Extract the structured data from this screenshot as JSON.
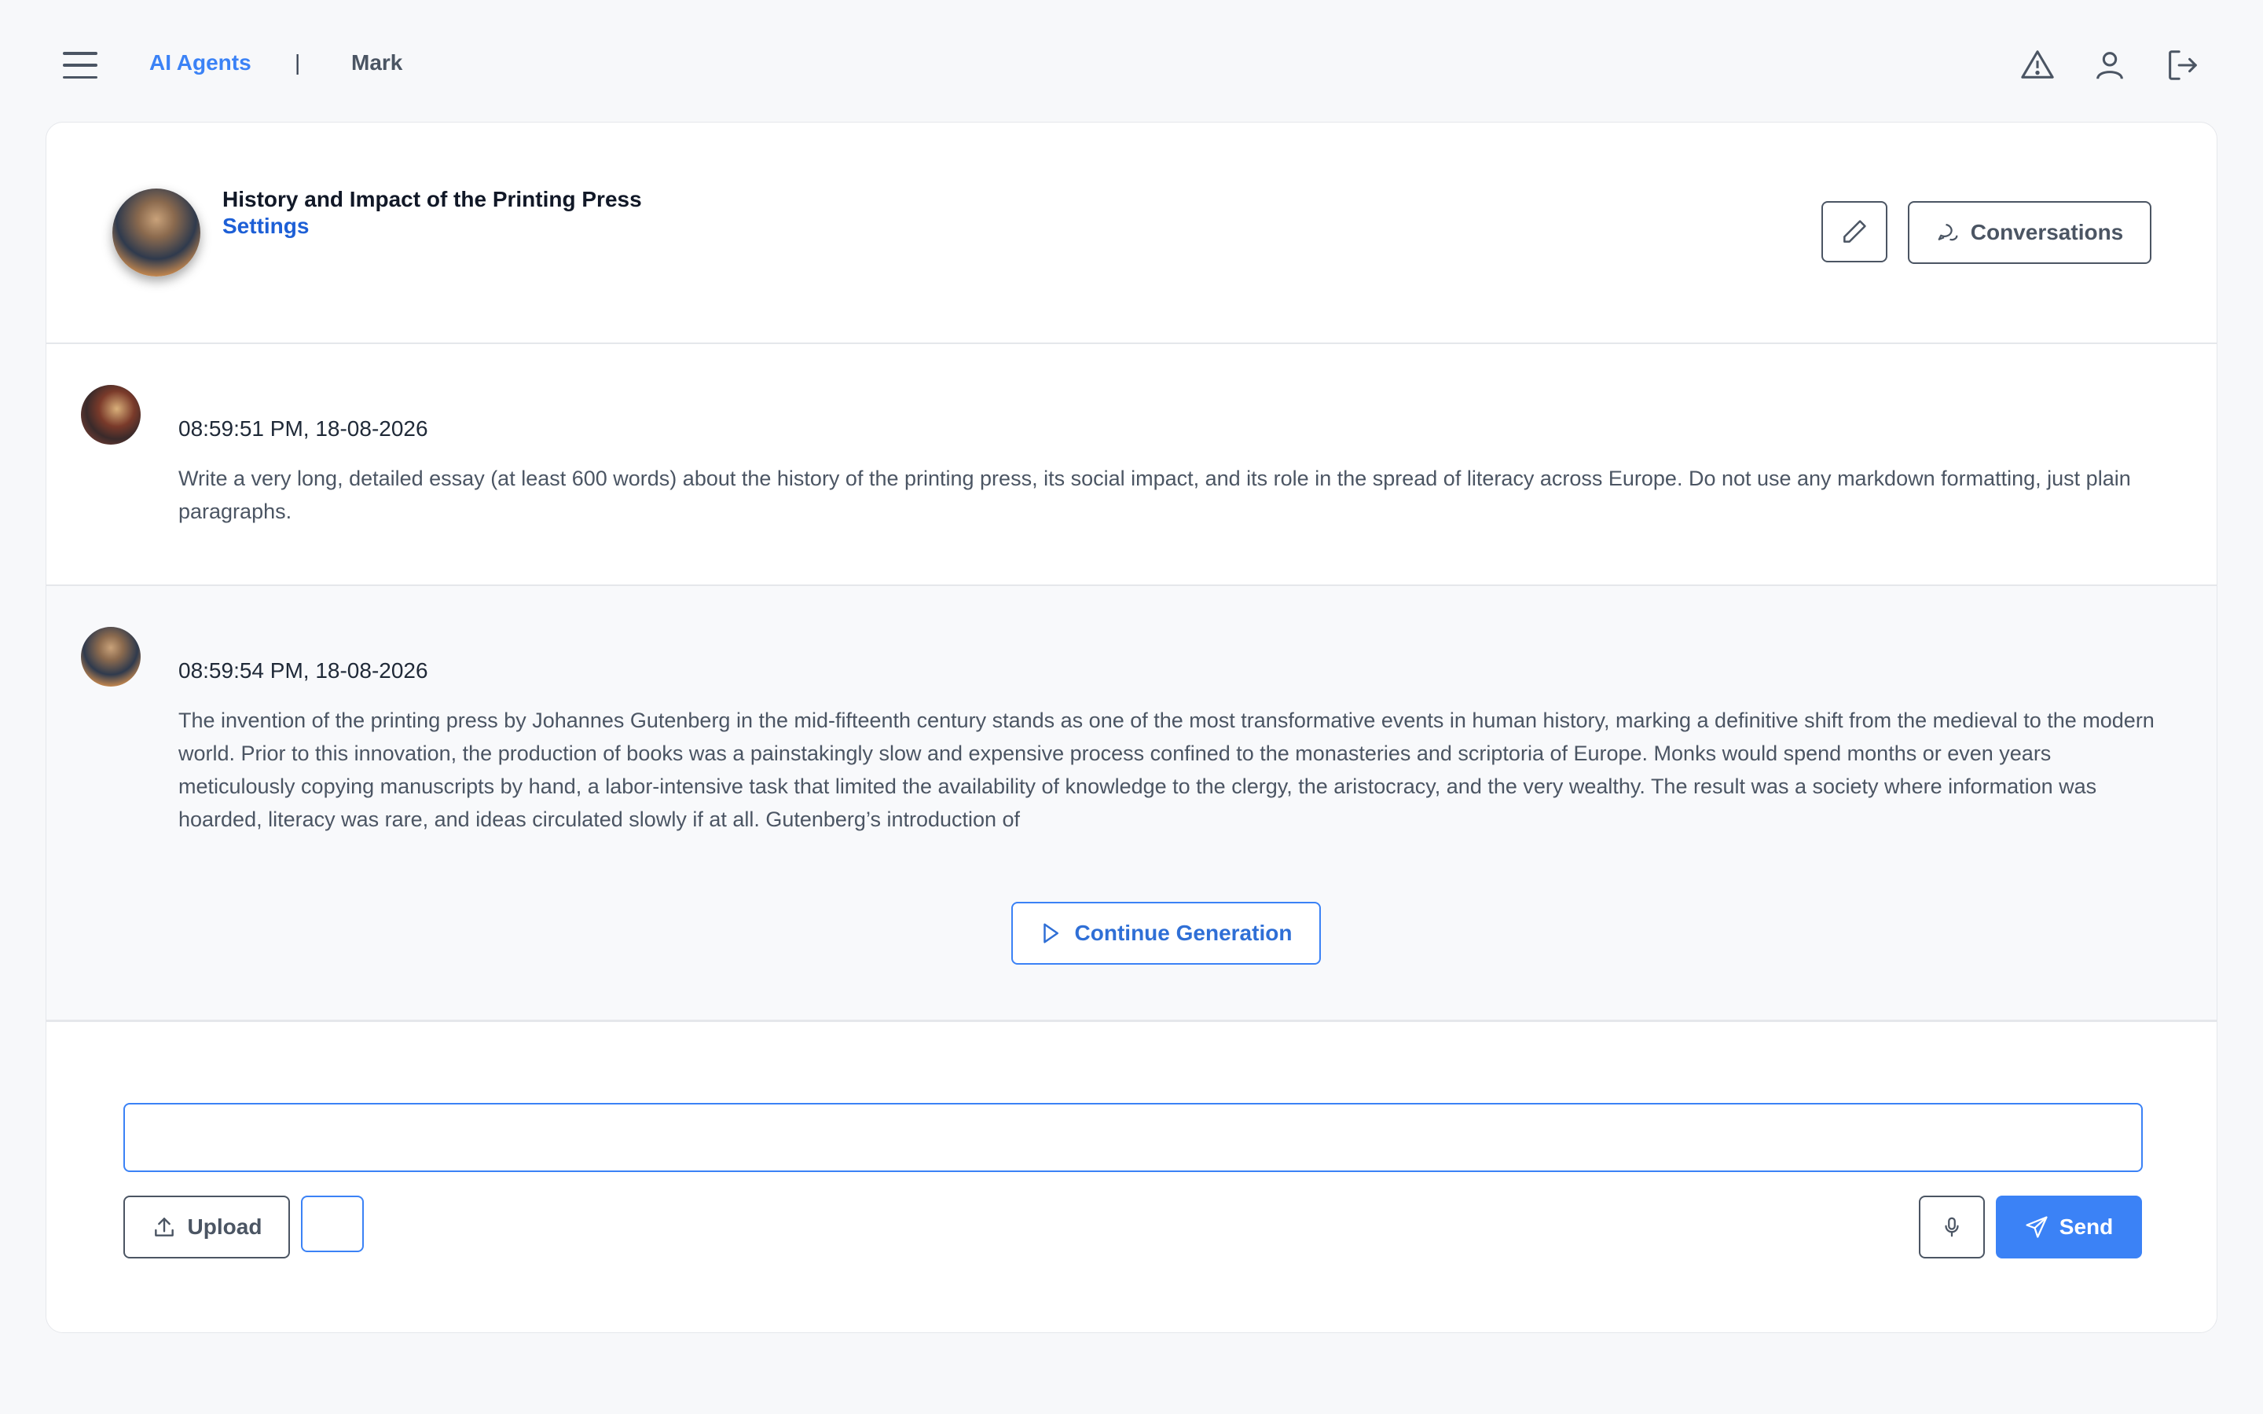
{
  "topbar": {
    "breadcrumb_home": "AI Agents",
    "breadcrumb_sep": "|",
    "breadcrumb_current": "Mark",
    "icons": [
      "menu-icon",
      "warning-icon",
      "user-icon",
      "logout-icon"
    ]
  },
  "agent": {
    "title": "History and Impact of the Printing Press",
    "settings_label": "Settings",
    "conversations_label": "Conversations"
  },
  "messages": [
    {
      "role": "user",
      "time": "08:59:51 PM, 18-08-2026",
      "text": "Write a very long, detailed essay (at least 600 words) about the history of the printing press, its social impact, and its role in the spread of literacy across Europe. Do not use any markdown formatting, just plain paragraphs."
    },
    {
      "role": "agent",
      "time": "08:59:54 PM, 18-08-2026",
      "text": "The invention of the printing press by Johannes Gutenberg in the mid-fifteenth century stands as one of the most transformative events in human history, marking a definitive shift from the medieval to the modern world. Prior to this innovation, the production of books was a painstakingly slow and expensive process confined to the monasteries and scriptoria of Europe. Monks would spend months or even years meticulously copying manuscripts by hand, a labor-intensive task that limited the availability of knowledge to the clergy, the aristocracy, and the very wealthy. The result was a society where information was hoarded, literacy was rare, and ideas circulated slowly if at all. Gutenberg’s introduction of"
    }
  ],
  "continue_label": "Continue Generation",
  "composer": {
    "input_value": "",
    "upload_label": "Upload",
    "send_label": "Send"
  },
  "colors": {
    "accent": "#3b82f6",
    "settings_link": "#1d5fd6",
    "background": "#f7f8fa"
  }
}
